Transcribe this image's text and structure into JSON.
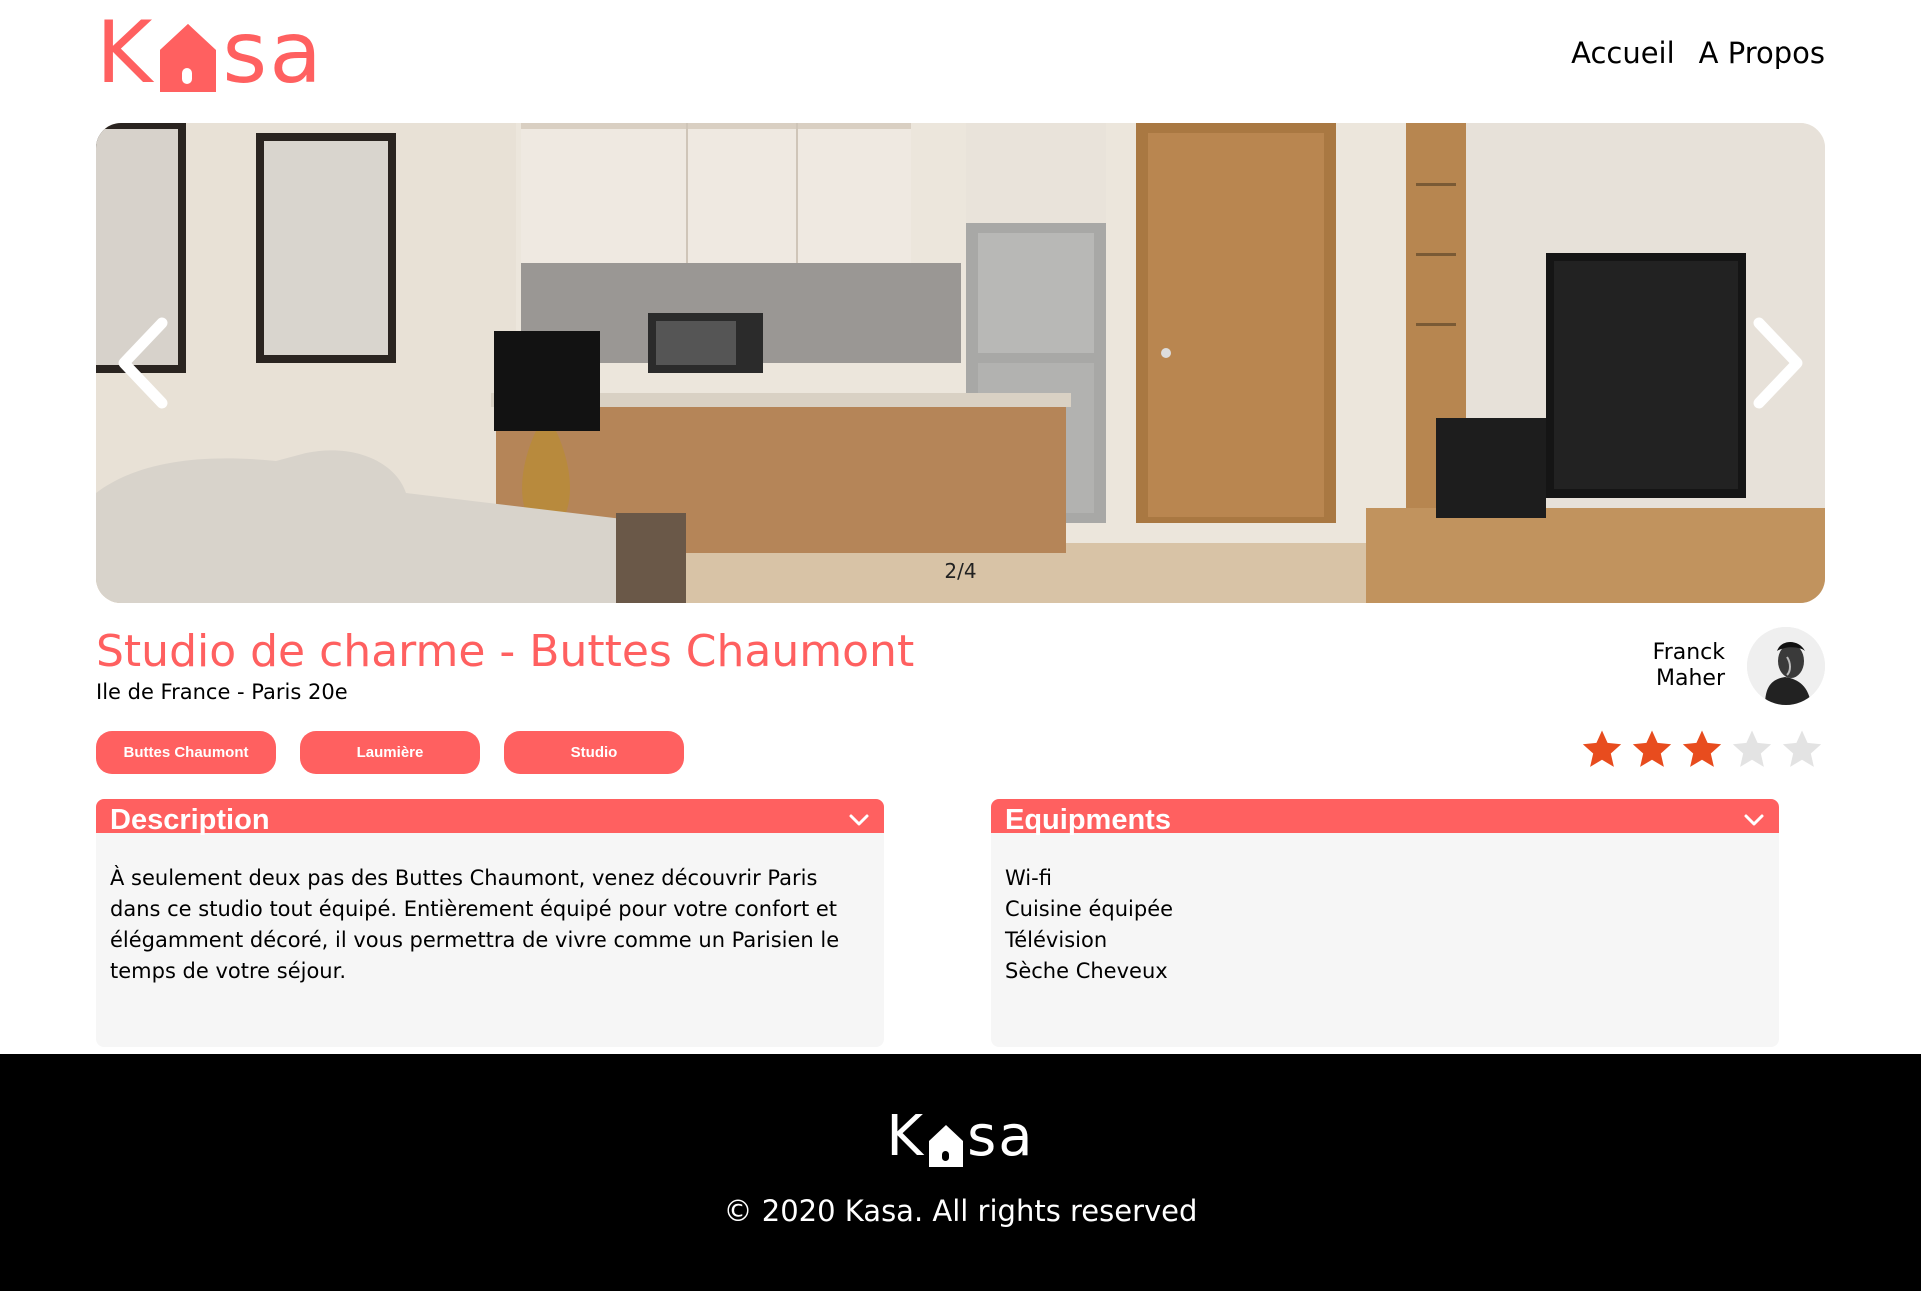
{
  "header": {
    "logo_k": "K",
    "logo_sa": "sa",
    "nav": [
      {
        "label": "Accueil"
      },
      {
        "label": "A Propos"
      }
    ]
  },
  "slideshow": {
    "counter": "2/4",
    "current_index": 2,
    "total": 4
  },
  "listing": {
    "title": "Studio de charme - Buttes Chaumont",
    "location": "Ile de France - Paris 20e",
    "host": {
      "first_name": "Franck",
      "last_name": "Maher"
    },
    "tags": [
      "Buttes Chaumont",
      "Laumière",
      "Studio"
    ],
    "rating": 3,
    "rating_max": 5
  },
  "description": {
    "title": "Description",
    "text": "À seulement deux pas des Buttes Chaumont, venez découvrir Paris dans ce studio tout équipé. Entièrement équipé pour votre confort et élégamment décoré, il vous permettra de vivre comme un Parisien le temps de votre séjour."
  },
  "equipments": {
    "title": "Equipments",
    "items": [
      "Wi-fi",
      "Cuisine équipée",
      "Télévision",
      "Sèche Cheveux"
    ]
  },
  "footer": {
    "logo_k": "K",
    "logo_sa": "sa",
    "copyright_symbol": "©",
    "copyright": "2020 Kasa. All rights reserved"
  },
  "colors": {
    "accent": "#FF6060",
    "star_filled": "#E84C1E",
    "star_empty": "#E3E3E3",
    "collapse_bg": "#F6F6F6",
    "footer_bg": "#000000"
  },
  "icons": {
    "logo_house": "house-icon",
    "prev": "chevron-left-icon",
    "next": "chevron-right-icon",
    "collapse_toggle": "chevron-down-icon",
    "star": "star-icon"
  }
}
